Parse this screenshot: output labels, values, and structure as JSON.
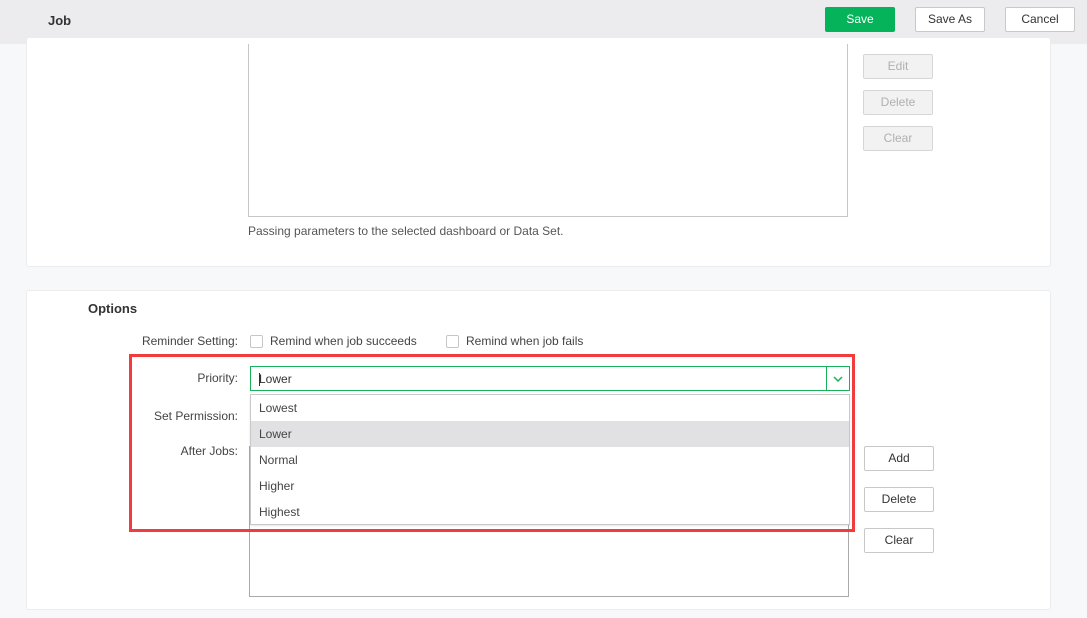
{
  "header": {
    "title": "Job",
    "save_label": "Save",
    "save_as_label": "Save As",
    "cancel_label": "Cancel"
  },
  "parameters": {
    "hint": "Passing parameters to the selected dashboard or Data Set.",
    "buttons": {
      "edit": "Edit",
      "delete": "Delete",
      "clear": "Clear"
    }
  },
  "options": {
    "title": "Options",
    "reminder_label": "Reminder Setting:",
    "remind_success_label": "Remind when job succeeds",
    "remind_fail_label": "Remind when job fails",
    "priority_label": "Priority:",
    "priority_value": "Lower",
    "priority_options": [
      {
        "label": "Lowest",
        "active": false
      },
      {
        "label": "Lower",
        "active": true
      },
      {
        "label": "Normal",
        "active": false
      },
      {
        "label": "Higher",
        "active": false
      },
      {
        "label": "Highest",
        "active": false
      }
    ],
    "set_permission_label": "Set Permission:",
    "after_jobs_label": "After Jobs:",
    "after_jobs_buttons": {
      "add": "Add",
      "delete": "Delete",
      "clear": "Clear"
    }
  },
  "colors": {
    "accent": "#05b45a",
    "highlight": "#f03c3c"
  }
}
